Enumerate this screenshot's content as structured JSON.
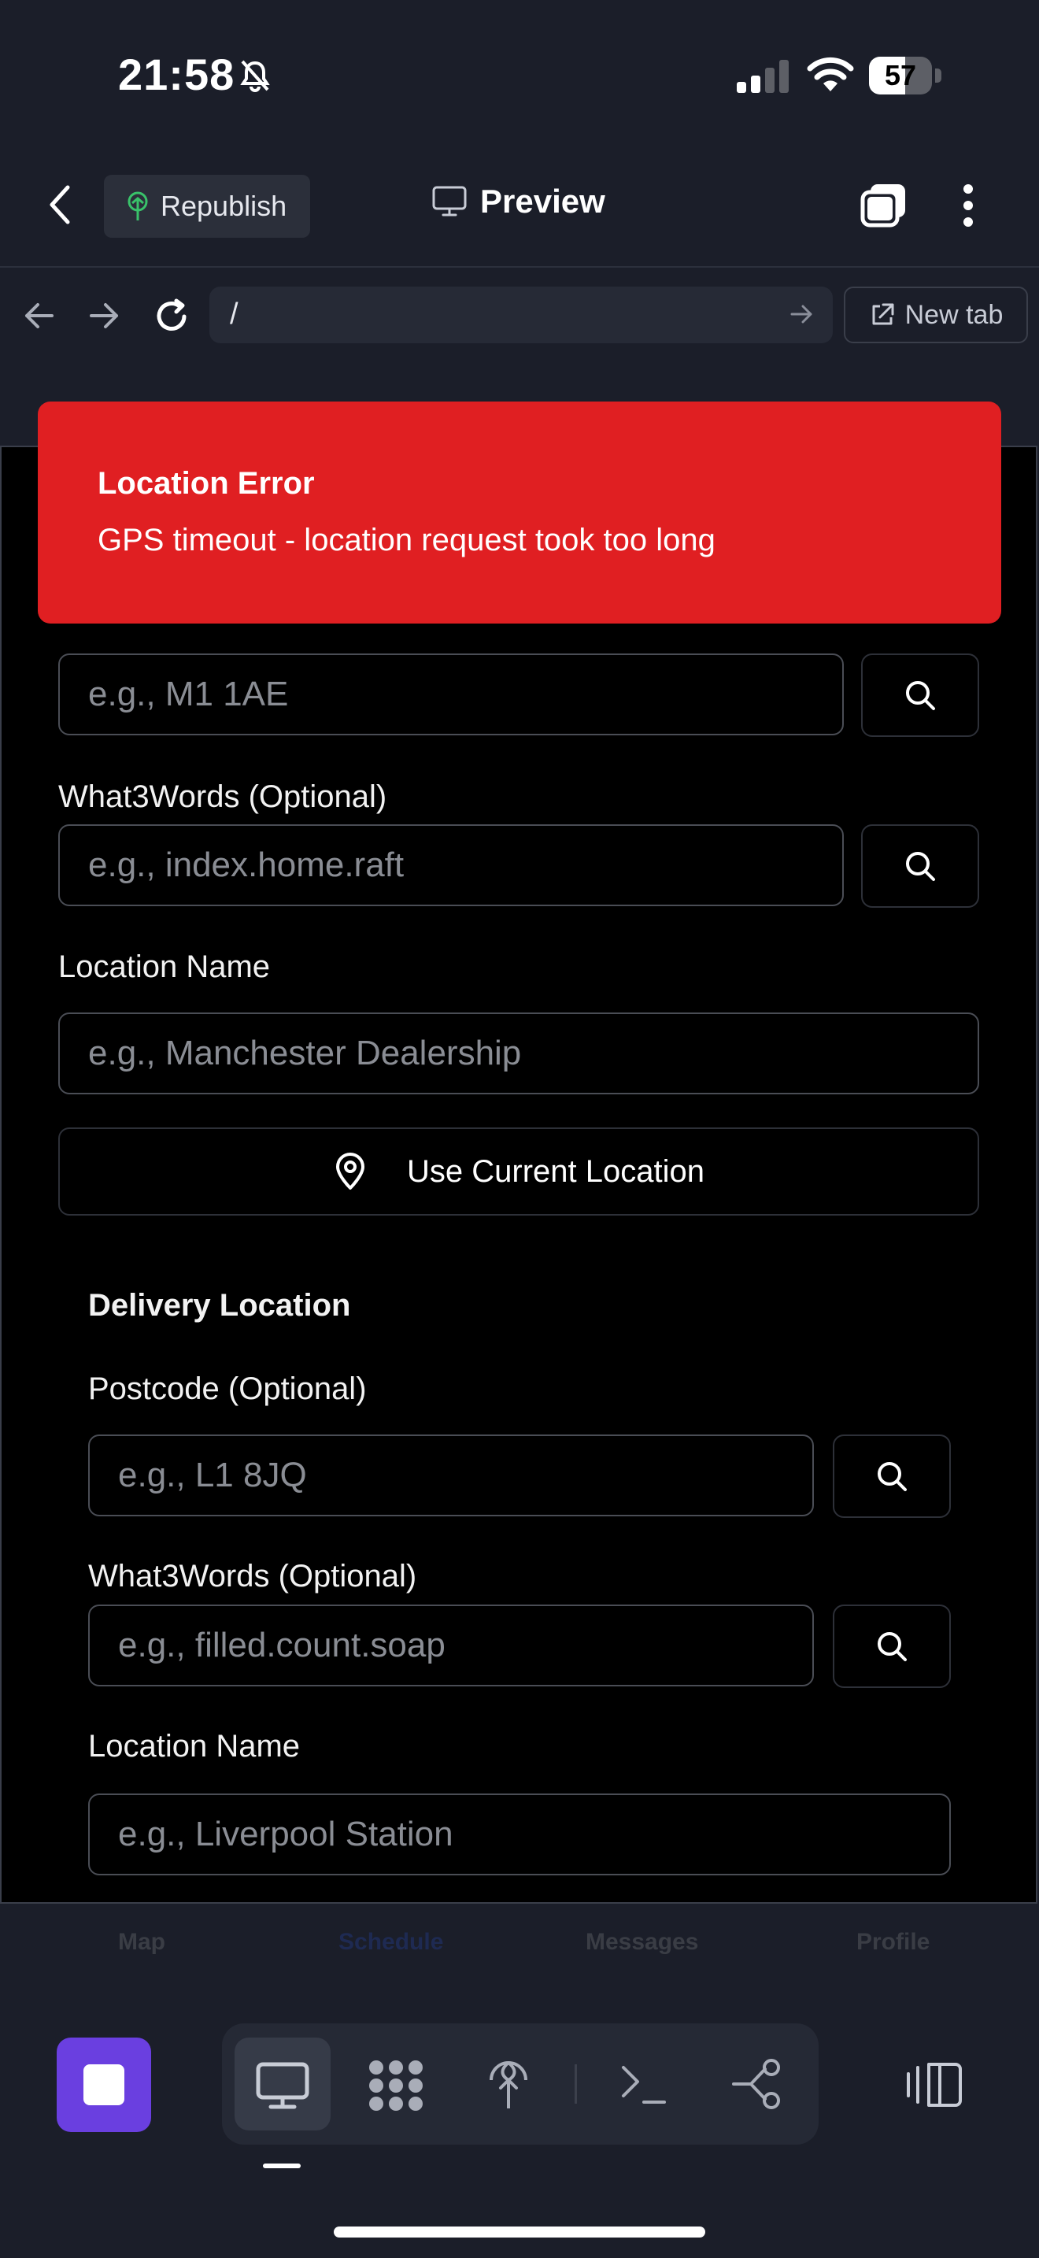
{
  "status_bar": {
    "time": "21:58",
    "battery": "57"
  },
  "header": {
    "republish_label": "Republish",
    "title": "Preview"
  },
  "browser": {
    "url": "/",
    "new_tab_label": "New tab"
  },
  "toast": {
    "title": "Location Error",
    "message": "GPS timeout - location request took too long"
  },
  "pickup": {
    "postcode_placeholder": "e.g., M1 1AE",
    "w3w_label": "What3Words (Optional)",
    "w3w_placeholder": "e.g., index.home.raft",
    "location_name_label": "Location Name",
    "location_name_placeholder": "e.g., Manchester Dealership",
    "use_current_location_label": "Use Current Location"
  },
  "delivery": {
    "section_title": "Delivery Location",
    "postcode_label": "Postcode (Optional)",
    "postcode_placeholder": "e.g., L1 8JQ",
    "w3w_label": "What3Words (Optional)",
    "w3w_placeholder": "e.g., filled.count.soap",
    "location_name_label": "Location Name",
    "location_name_placeholder": "e.g., Liverpool Station"
  },
  "bottom_nav": {
    "items": [
      "Map",
      "Schedule",
      "Messages",
      "Profile"
    ]
  },
  "colors": {
    "error": "#e01f22",
    "accent": "#6a3fe0",
    "background": "#1b1e29"
  }
}
